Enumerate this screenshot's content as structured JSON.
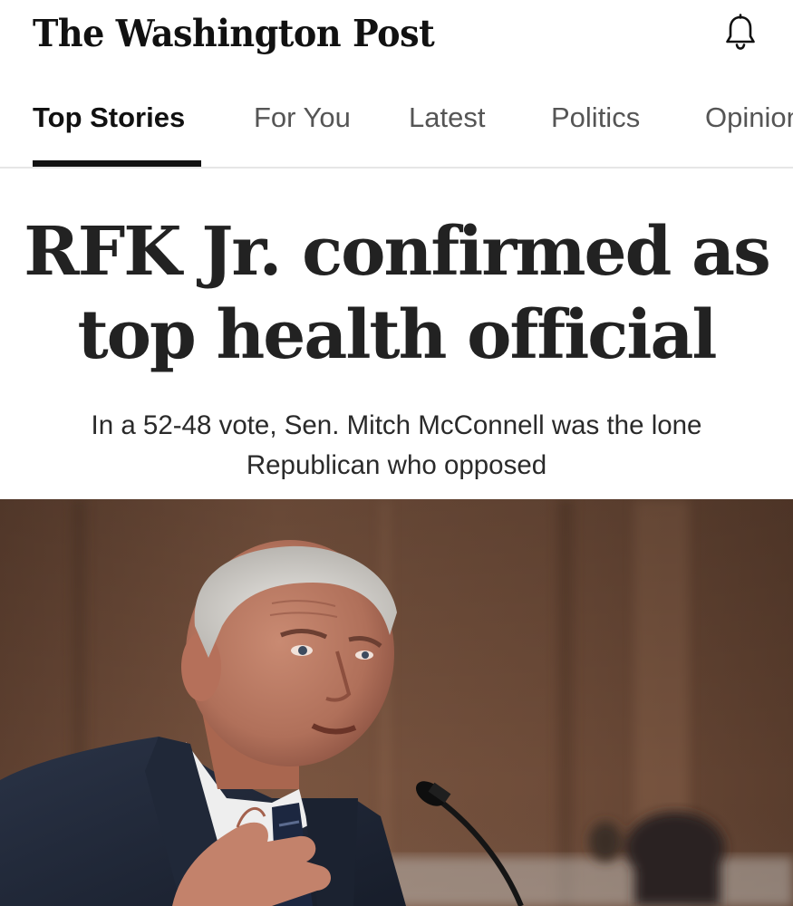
{
  "masthead": {
    "logo": "The Washington Post",
    "notifications_icon": "bell-icon"
  },
  "tabs": [
    {
      "label": "Top Stories",
      "active": true
    },
    {
      "label": "For You",
      "active": false
    },
    {
      "label": "Latest",
      "active": false
    },
    {
      "label": "Politics",
      "active": false
    },
    {
      "label": "Opinion",
      "active": false
    }
  ],
  "story": {
    "headline_line1": "RFK Jr. confirmed as",
    "headline_line2": "top health official",
    "subhead": "In a 52-48 vote, Sen. Mitch McConnell was the lone Republican who opposed"
  },
  "colors": {
    "text": "#111111",
    "tab_inactive": "#555555",
    "divider": "#e6e6e6",
    "photo_background": "#6b4a36"
  }
}
